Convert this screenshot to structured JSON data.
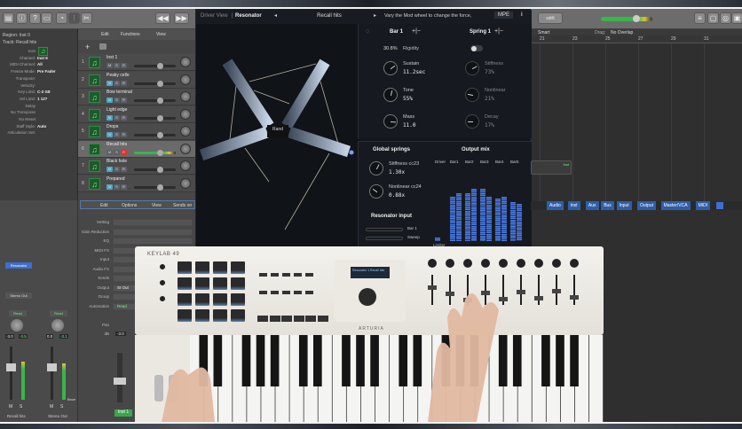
{
  "control_bar": {
    "lcd_text": "sdrlt",
    "buttons": [
      "library",
      "inspector",
      "quick-help",
      "toolbar",
      "smart-controls",
      "mixer",
      "editors",
      "rewind",
      "forward"
    ]
  },
  "inspector": {
    "region": "Region: Inst 0",
    "track": "Track: Recall hits",
    "rows": [
      {
        "k": "Icon",
        "v": ""
      },
      {
        "k": "Channel:",
        "v": "Inst 6"
      },
      {
        "k": "MIDI Channel:",
        "v": "All"
      },
      {
        "k": "Freeze Mode:",
        "v": "Pre Fader"
      },
      {
        "k": "Transpose:",
        "v": ""
      },
      {
        "k": "Velocity:",
        "v": ""
      },
      {
        "k": "Key Limit:",
        "v": "C-2 G8"
      },
      {
        "k": "Vel Limit:",
        "v": "1 127"
      },
      {
        "k": "Delay",
        "v": ""
      },
      {
        "k": "No Transpose",
        "v": ""
      },
      {
        "k": "No Reset",
        "v": ""
      },
      {
        "k": "Staff Style:",
        "v": "Auto"
      },
      {
        "k": "Articulation Set:",
        "v": ""
      }
    ]
  },
  "tracks_header": {
    "edit": "Edit",
    "functions": "Functions",
    "view": "View"
  },
  "tracks": [
    {
      "num": "1",
      "name": "Inst 1"
    },
    {
      "num": "2",
      "name": "Peaky cello"
    },
    {
      "num": "3",
      "name": "Bow terminal"
    },
    {
      "num": "4",
      "name": "Light edge"
    },
    {
      "num": "5",
      "name": "Drops"
    },
    {
      "num": "6",
      "name": "Recall hits",
      "selected": true
    },
    {
      "num": "7",
      "name": "Black hole"
    },
    {
      "num": "8",
      "name": "Prepared"
    }
  ],
  "track_buttons": {
    "mute": "M",
    "solo": "S",
    "record": "R"
  },
  "mixer": {
    "menu": {
      "edit": "Edit",
      "options": "Options",
      "view": "View",
      "sends": "Sends on"
    },
    "labels": [
      "Setting",
      "Gain Reduction",
      "EQ",
      "MIDI FX",
      "Input",
      "Audio FX",
      "Sends",
      "Output",
      "Group",
      "Automation",
      "",
      "Pan",
      "dB"
    ],
    "output_value": "St Out",
    "automation_value": "Read",
    "db_value": "-3.0",
    "strip_name": "Inst 1",
    "channels": [
      {
        "name": "Recall hits",
        "insert": "Resonator",
        "output": "Stereo Out",
        "automation": "Read",
        "vol": "-3.0",
        "peak": "-3.5",
        "m": "M",
        "s": "S",
        "level": 0.72
      },
      {
        "name": "Stereo Out",
        "insert": "",
        "output": "",
        "automation": "Read",
        "vol": "0.0",
        "peak": "-3.1",
        "m": "M",
        "s": "S",
        "level": 0.68,
        "bounce": "Bnce"
      }
    ]
  },
  "plugin": {
    "view_label": "Driver View",
    "name": "Resonator",
    "preset": "Recall hits",
    "hint": "Vary the Mod wheel to change the force,",
    "mpe": "MPE",
    "info": "i",
    "node_label": "Rand",
    "bar_section": {
      "title": "Bar 1",
      "add_remove": "+|−",
      "rigidity_value": "30.8%",
      "rigidity_label": "Rigidity",
      "knobs": [
        {
          "label": "Sustain",
          "value": "11.2sec",
          "level": 0.7
        },
        {
          "label": "Tone",
          "value": "55%",
          "level": 0.55
        },
        {
          "label": "Mass",
          "value": "11.0",
          "level": 0.85
        }
      ]
    },
    "spring_section": {
      "title": "Spring 1",
      "add_remove": "+|−",
      "knobs": [
        {
          "label": "Stiffness",
          "value": "73%",
          "level": 0.73
        },
        {
          "label": "Nonlinear",
          "value": "21%",
          "level": 0.21
        },
        {
          "label": "Decay",
          "value": "17%",
          "level": 0.17
        }
      ]
    },
    "global_springs": {
      "title": "Global springs",
      "knobs": [
        {
          "label": "Stiffness cc23",
          "value": "1.30x",
          "level": 0.6
        },
        {
          "label": "Nonlinear cc24",
          "value": "0.88x",
          "level": 0.3
        }
      ]
    },
    "resonator_input": {
      "title": "Resonator input",
      "rows": [
        {
          "label": "Bar 1"
        },
        {
          "label": "Sweep"
        }
      ]
    },
    "output_mix": {
      "title": "Output mix",
      "limiter": "Limiter",
      "channels": [
        {
          "label": "Driver",
          "levels": [
            0.05
          ]
        },
        {
          "label": "Bar1",
          "levels": [
            0.62,
            0.68
          ]
        },
        {
          "label": "Bar2",
          "levels": [
            0.68,
            0.74
          ]
        },
        {
          "label": "Bar3",
          "levels": [
            0.74,
            0.62
          ]
        },
        {
          "label": "Bar4",
          "levels": [
            0.6,
            0.63
          ]
        },
        {
          "label": "Bar5",
          "levels": [
            0.55,
            0.52
          ]
        }
      ]
    }
  },
  "arrange": {
    "tool": "Smart",
    "drag_label": "Drag:",
    "drag_value": "No Overlap",
    "ruler": [
      "21",
      "23",
      "25",
      "27",
      "29",
      "31"
    ],
    "region_label": "Inst",
    "mixer_tabs": [
      "Audio",
      "Inst",
      "Aux",
      "Bus",
      "Input",
      "Output",
      "Master/VCA",
      "MIDI"
    ],
    "master_level": 0.68
  },
  "keyboard": {
    "brand": "KEYLAB 49",
    "maker": "ARTURIA",
    "display": "Resonator 1 Recall hits",
    "white_keys": 29
  }
}
